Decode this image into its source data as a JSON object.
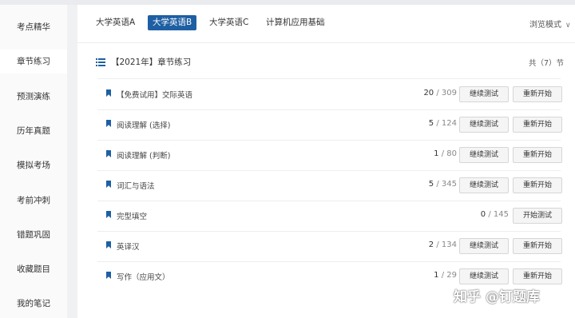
{
  "sidebar": {
    "items": [
      {
        "label": "考点精华"
      },
      {
        "label": "章节练习"
      },
      {
        "label": "预测演练"
      },
      {
        "label": "历年真题"
      },
      {
        "label": "模拟考场"
      },
      {
        "label": "考前冲刺"
      },
      {
        "label": "错题巩固"
      },
      {
        "label": "收藏题目"
      },
      {
        "label": "我的笔记"
      }
    ],
    "active_index": 1
  },
  "tabs": [
    {
      "label": "大学英语A"
    },
    {
      "label": "大学英语B"
    },
    {
      "label": "大学英语C"
    },
    {
      "label": "计算机应用基础"
    }
  ],
  "active_tab": 1,
  "browse_mode": {
    "label": "浏览模式"
  },
  "section": {
    "title": "【2021年】章节练习",
    "count": "共（7）节"
  },
  "rows": [
    {
      "name": "【免费试用】交际英语",
      "done": "20",
      "sep": " / ",
      "total": "309",
      "btn1": "继续测试",
      "btn2": "重新开始"
    },
    {
      "name": "阅读理解 (选择)",
      "done": "5",
      "sep": " / ",
      "total": "124",
      "btn1": "继续测试",
      "btn2": "重新开始"
    },
    {
      "name": "阅读理解 (判断)",
      "done": "1",
      "sep": " / ",
      "total": "80",
      "btn1": "继续测试",
      "btn2": "重新开始"
    },
    {
      "name": "词汇与语法",
      "done": "5",
      "sep": " / ",
      "total": "345",
      "btn1": "继续测试",
      "btn2": "重新开始"
    },
    {
      "name": "完型填空",
      "done": "0",
      "sep": " / ",
      "total": "145",
      "btn2": "开始测试"
    },
    {
      "name": "英译汉",
      "done": "2",
      "sep": " / ",
      "total": "134",
      "btn1": "继续测试",
      "btn2": "重新开始"
    },
    {
      "name": "写作（应用文）",
      "done": "1",
      "sep": " / ",
      "total": "29",
      "btn1": "继续测试",
      "btn2": "重新开始"
    }
  ],
  "watermark": "知乎 @钉题库",
  "colors": {
    "accent": "#1e5fa3"
  }
}
